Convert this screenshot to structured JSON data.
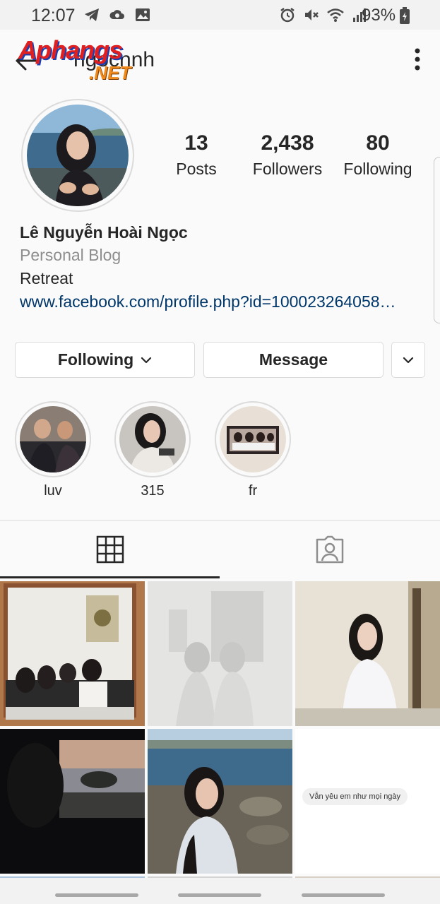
{
  "status_bar": {
    "time": "12:07",
    "battery": "93%",
    "left_icons": [
      "telegram-icon",
      "cloud-sync-icon",
      "gallery-icon"
    ],
    "right_icons": [
      "alarm-icon",
      "mute-icon",
      "wifi-icon",
      "signal-icon",
      "battery-icon"
    ]
  },
  "header": {
    "username": "ngocnnh",
    "logo_top": "Aphangs",
    "logo_bottom": ".NET",
    "back_icon": "back-arrow-icon",
    "more_icon": "more-vertical-icon"
  },
  "profile": {
    "stats": [
      {
        "count": "13",
        "label": "Posts"
      },
      {
        "count": "2,438",
        "label": "Followers"
      },
      {
        "count": "80",
        "label": "Following"
      }
    ],
    "full_name": "Lê Nguyễn Hoài Ngọc",
    "category": "Personal Blog",
    "bio": "Retreat",
    "link": "www.facebook.com/profile.php?id=100023264058…"
  },
  "actions": {
    "following_label": "Following",
    "message_label": "Message"
  },
  "highlights": [
    {
      "label": "luv"
    },
    {
      "label": "315"
    },
    {
      "label": "fr"
    }
  ],
  "tabs": [
    {
      "icon": "grid-icon",
      "active": true
    },
    {
      "icon": "tagged-icon",
      "active": false
    }
  ],
  "grid": {
    "quote_text": "Vẫn yêu em như mọi ngày"
  },
  "colors": {
    "link": "#00376b",
    "muted": "#8e8e8e",
    "border": "#dbdbdb",
    "text": "#262626"
  }
}
